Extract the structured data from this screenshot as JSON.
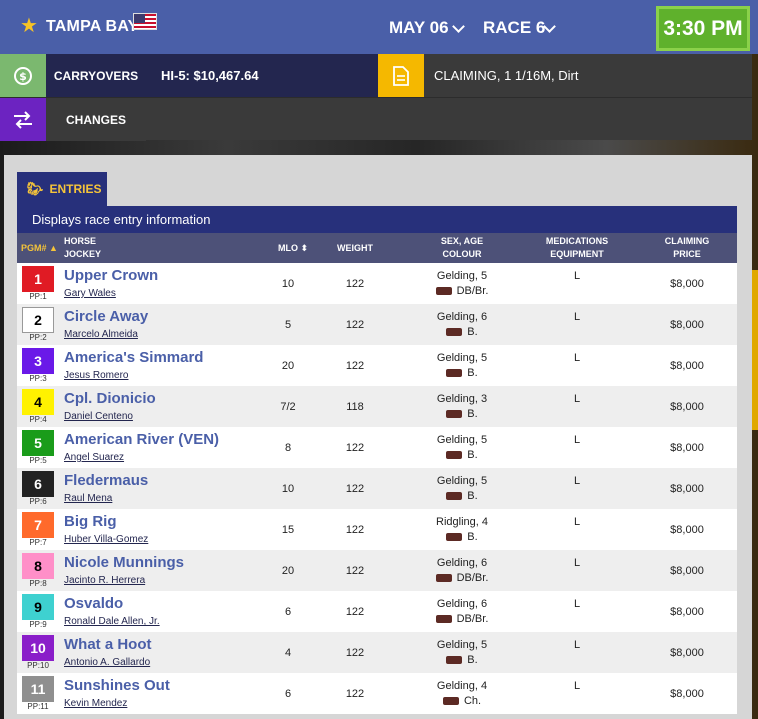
{
  "header": {
    "track": "TAMPA BAY",
    "date": "MAY 06",
    "race": "RACE 6",
    "post_time": "3:30 PM"
  },
  "carryovers": {
    "label": "CARRYOVERS",
    "value": "HI-5: $10,467.64"
  },
  "race_info": "CLAIMING, 1 1/16M, Dirt",
  "changes": {
    "label": "CHANGES"
  },
  "entries": {
    "tab_label": "ENTRIES",
    "description": "Displays race entry information",
    "columns": {
      "pgm": "PGM#",
      "horse": "HORSE",
      "jockey": "JOCKEY",
      "mlo": "MLO",
      "weight": "WEIGHT",
      "sex_age": "SEX, AGE",
      "colour": "COLOUR",
      "medications": "MEDICATIONS",
      "equipment": "EQUIPMENT",
      "claiming": "CLAIMING",
      "price": "PRICE"
    },
    "rows": [
      {
        "pgm": "1",
        "pp": "PP:1",
        "horse": "Upper Crown",
        "jockey": "Gary Wales",
        "mlo": "10",
        "weight": "122",
        "sex": "Gelding, 5",
        "colour": "DB/Br.",
        "med": "L",
        "price": "$8,000",
        "bg": "#e01b24",
        "fg": "#ffffff"
      },
      {
        "pgm": "2",
        "pp": "PP:2",
        "horse": "Circle Away",
        "jockey": "Marcelo Almeida",
        "mlo": "5",
        "weight": "122",
        "sex": "Gelding, 6",
        "colour": "B.",
        "med": "L",
        "price": "$8,000",
        "bg": "#ffffff",
        "fg": "#000000"
      },
      {
        "pgm": "3",
        "pp": "PP:3",
        "horse": "America's Simmard",
        "jockey": "Jesus Romero",
        "mlo": "20",
        "weight": "122",
        "sex": "Gelding, 5",
        "colour": "B.",
        "med": "L",
        "price": "$8,000",
        "bg": "#6a19e8",
        "fg": "#ffffff"
      },
      {
        "pgm": "4",
        "pp": "PP:4",
        "horse": "Cpl. Dionicio",
        "jockey": "Daniel Centeno",
        "mlo": "7/2",
        "weight": "118",
        "sex": "Gelding, 3",
        "colour": "B.",
        "med": "L",
        "price": "$8,000",
        "bg": "#fff200",
        "fg": "#000000"
      },
      {
        "pgm": "5",
        "pp": "PP:5",
        "horse": "American River (VEN)",
        "jockey": "Angel Suarez",
        "mlo": "8",
        "weight": "122",
        "sex": "Gelding, 5",
        "colour": "B.",
        "med": "L",
        "price": "$8,000",
        "bg": "#1a9c1a",
        "fg": "#ffffff"
      },
      {
        "pgm": "6",
        "pp": "PP:6",
        "horse": "Fledermaus",
        "jockey": "Raul Mena",
        "mlo": "10",
        "weight": "122",
        "sex": "Gelding, 5",
        "colour": "B.",
        "med": "L",
        "price": "$8,000",
        "bg": "#222222",
        "fg": "#ffffff"
      },
      {
        "pgm": "7",
        "pp": "PP:7",
        "horse": "Big Rig",
        "jockey": "Huber Villa-Gomez",
        "mlo": "15",
        "weight": "122",
        "sex": "Ridgling, 4",
        "colour": "B.",
        "med": "L",
        "price": "$8,000",
        "bg": "#ff6a2b",
        "fg": "#ffffff"
      },
      {
        "pgm": "8",
        "pp": "PP:8",
        "horse": "Nicole Munnings",
        "jockey": "Jacinto R. Herrera",
        "mlo": "20",
        "weight": "122",
        "sex": "Gelding, 6",
        "colour": "DB/Br.",
        "med": "L",
        "price": "$8,000",
        "bg": "#ff8fc8",
        "fg": "#000000"
      },
      {
        "pgm": "9",
        "pp": "PP:9",
        "horse": "Osvaldo",
        "jockey": "Ronald Dale Allen, Jr.",
        "mlo": "6",
        "weight": "122",
        "sex": "Gelding, 6",
        "colour": "DB/Br.",
        "med": "L",
        "price": "$8,000",
        "bg": "#3ed1d0",
        "fg": "#000000"
      },
      {
        "pgm": "10",
        "pp": "PP:10",
        "horse": "What a Hoot",
        "jockey": "Antonio A. Gallardo",
        "mlo": "4",
        "weight": "122",
        "sex": "Gelding, 5",
        "colour": "B.",
        "med": "L",
        "price": "$8,000",
        "bg": "#8a1ec9",
        "fg": "#ffffff"
      },
      {
        "pgm": "11",
        "pp": "PP:11",
        "horse": "Sunshines Out",
        "jockey": "Kevin Mendez",
        "mlo": "6",
        "weight": "122",
        "sex": "Gelding, 4",
        "colour": "Ch.",
        "med": "L",
        "price": "$8,000",
        "bg": "#8f8f8f",
        "fg": "#ffffff"
      }
    ]
  }
}
